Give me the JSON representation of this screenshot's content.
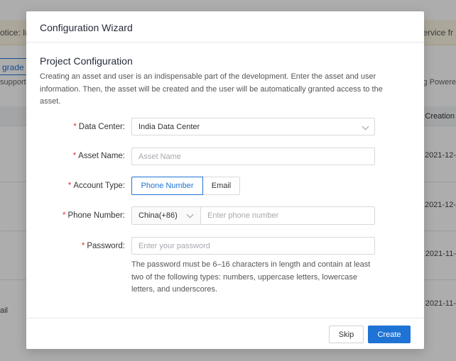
{
  "background": {
    "notice_left": "otice: In",
    "notice_right": "service fr",
    "upgrade_link": "grade lo",
    "support_left": "supportin",
    "support_right": "sing Powere",
    "table_header_creation": "Creation",
    "row_dates": [
      "2021-12-",
      "2021-12-",
      "2021-11-",
      "2021-11-"
    ],
    "row_tail": "ail"
  },
  "dialog": {
    "title": "Configuration Wizard",
    "section_title": "Project Configuration",
    "description": "Creating an asset and user is an indispensable part of the development. Enter the asset and user information. Then, the asset will be created and the user will be automatically granted access to the asset.",
    "required_mark": "*",
    "fields": {
      "data_center": {
        "label": "Data Center:",
        "value": "India Data Center"
      },
      "asset_name": {
        "label": "Asset Name:",
        "placeholder": "Asset Name"
      },
      "account_type": {
        "label": "Account Type:",
        "options": [
          "Phone Number",
          "Email"
        ],
        "selected": "Phone Number"
      },
      "phone_number": {
        "label": "Phone Number:",
        "country_code": "China(+86)",
        "placeholder": "Enter phone number"
      },
      "password": {
        "label": "Password:",
        "placeholder": "Enter your password",
        "hint": "The password must be 6–16 characters in length and contain at least two of the following types: numbers, uppercase letters, lowercase letters, and underscores."
      }
    },
    "footer": {
      "skip_label": "Skip",
      "create_label": "Create"
    }
  },
  "colors": {
    "primary": "#1f73d4",
    "required": "#e5333b",
    "notice_bg": "#fdf6e3"
  }
}
